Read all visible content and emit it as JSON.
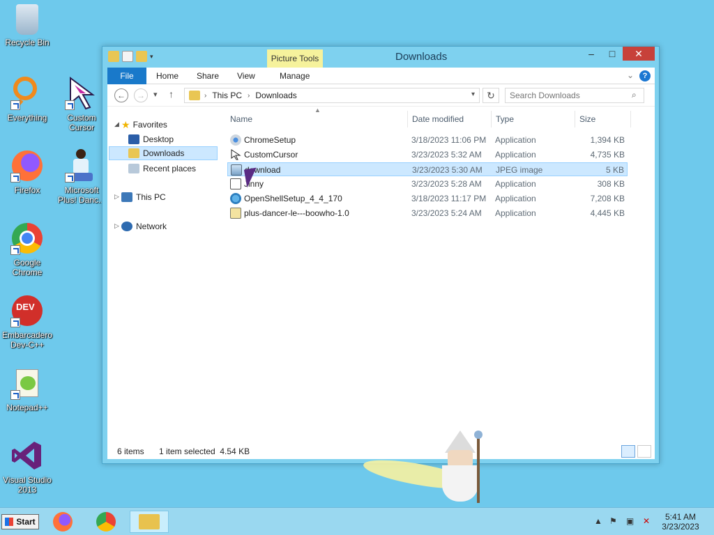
{
  "desktop": {
    "icons": [
      {
        "label": "Recycle Bin"
      },
      {
        "label": "Everything"
      },
      {
        "label": "Custom Cursor"
      },
      {
        "label": "Firefox"
      },
      {
        "label": "Microsoft Plus! Danc..."
      },
      {
        "label": "Google Chrome"
      },
      {
        "label": "Embarcadero Dev-C++"
      },
      {
        "label": "Notepad++"
      },
      {
        "label": "Visual Studio 2013"
      }
    ]
  },
  "window": {
    "title": "Downloads",
    "contextual_tab": "Picture Tools",
    "ribbon_tabs": [
      "File",
      "Home",
      "Share",
      "View",
      "Manage"
    ],
    "help_label": "?",
    "address": {
      "crumbs": [
        "This PC",
        "Downloads"
      ]
    },
    "search_placeholder": "Search Downloads",
    "nav": {
      "favorites_label": "Favorites",
      "favorites": [
        "Desktop",
        "Downloads",
        "Recent places"
      ],
      "this_pc_label": "This PC",
      "network_label": "Network"
    },
    "columns": [
      "Name",
      "Date modified",
      "Type",
      "Size"
    ],
    "files": [
      {
        "name": "ChromeSetup",
        "date": "3/18/2023 11:06 PM",
        "type": "Application",
        "size": "1,394 KB"
      },
      {
        "name": "CustomCursor",
        "date": "3/23/2023 5:32 AM",
        "type": "Application",
        "size": "4,735 KB"
      },
      {
        "name": "download",
        "date": "3/23/2023 5:30 AM",
        "type": "JPEG image",
        "size": "5 KB"
      },
      {
        "name": "Jinny",
        "date": "3/23/2023 5:28 AM",
        "type": "Application",
        "size": "308 KB"
      },
      {
        "name": "OpenShellSetup_4_4_170",
        "date": "3/18/2023 11:17 PM",
        "type": "Application",
        "size": "7,208 KB"
      },
      {
        "name": "plus-dancer-le---boowho-1.0",
        "date": "3/23/2023 5:24 AM",
        "type": "Application",
        "size": "4,445 KB"
      }
    ],
    "status": {
      "item_count": "6 items",
      "selection": "1 item selected  4.54 KB"
    }
  },
  "taskbar": {
    "start_label": "Start",
    "clock_time": "5:41 AM",
    "clock_date": "3/23/2023"
  },
  "colors": {
    "desktop_bg": "#6ec9ec",
    "file_tab": "#1979ca",
    "context_tab": "#f6f29c",
    "close_button": "#c7413a",
    "selection": "#cce8ff"
  }
}
